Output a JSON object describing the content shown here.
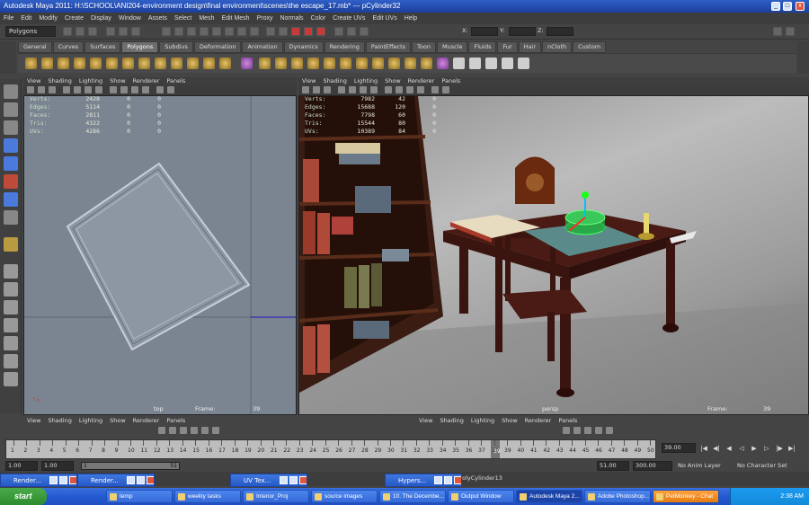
{
  "window": {
    "title": "Autodesk Maya 2011: H:\\SCHOOL\\ANI204-environment design\\final environment\\scenes\\the escape_17.mb*   ---   pCylinder32"
  },
  "menus": [
    "File",
    "Edit",
    "Modify",
    "Create",
    "Display",
    "Window",
    "Assets",
    "Select",
    "Mesh",
    "Edit Mesh",
    "Proxy",
    "Normals",
    "Color",
    "Create UVs",
    "Edit UVs",
    "Help"
  ],
  "status_line": {
    "mode": "Polygons",
    "x_label": "X:",
    "y_label": "Y:",
    "z_label": "Z:"
  },
  "shelf_tabs": [
    "General",
    "Curves",
    "Surfaces",
    "Polygons",
    "Subdivs",
    "Deformation",
    "Animation",
    "Dynamics",
    "Rendering",
    "PaintEffects",
    "Toon",
    "Muscle",
    "Fluids",
    "Fur",
    "Hair",
    "nCloth",
    "Custom"
  ],
  "active_shelf_tab": "Polygons",
  "panel_menu": [
    "View",
    "Shading",
    "Lighting",
    "Show",
    "Renderer",
    "Panels"
  ],
  "left_viewport": {
    "hud_rows": [
      {
        "label": "Verts:",
        "a": "2428",
        "b": "0",
        "c": "0"
      },
      {
        "label": "Edges:",
        "a": "5114",
        "b": "0",
        "c": "0"
      },
      {
        "label": "Faces:",
        "a": "2811",
        "b": "0",
        "c": "0"
      },
      {
        "label": "Tris:",
        "a": "4322",
        "b": "0",
        "c": "0"
      },
      {
        "label": "UVs:",
        "a": "4286",
        "b": "0",
        "c": "0"
      }
    ],
    "camera": "top",
    "frame_label": "Frame:",
    "frame": "39"
  },
  "right_viewport": {
    "hud_rows": [
      {
        "label": "Verts:",
        "a": "7982",
        "b": "42",
        "c": "0"
      },
      {
        "label": "Edges:",
        "a": "15688",
        "b": "120",
        "c": "0"
      },
      {
        "label": "Faces:",
        "a": "7798",
        "b": "60",
        "c": "0"
      },
      {
        "label": "Tris:",
        "a": "15544",
        "b": "80",
        "c": "0"
      },
      {
        "label": "UVs:",
        "a": "10389",
        "b": "84",
        "c": "0"
      }
    ],
    "camera": "persp",
    "frame_label": "Frame:",
    "frame": "39"
  },
  "timeline": {
    "ticks": [
      "1",
      "2",
      "3",
      "4",
      "5",
      "6",
      "7",
      "8",
      "9",
      "10",
      "11",
      "12",
      "13",
      "14",
      "15",
      "16",
      "17",
      "18",
      "19",
      "20",
      "21",
      "22",
      "23",
      "24",
      "25",
      "26",
      "27",
      "28",
      "29",
      "30",
      "31",
      "32",
      "33",
      "34",
      "35",
      "36",
      "37",
      "38",
      "39",
      "40",
      "41",
      "42",
      "43",
      "44",
      "45",
      "46",
      "47",
      "48",
      "49",
      "50"
    ],
    "current_frame": "39.00",
    "current_marker": "39"
  },
  "range": {
    "start": "1.00",
    "playback_start": "1.00",
    "slider_start": "1",
    "slider_end": "51",
    "playback_end": "51.00",
    "end": "300.00",
    "anim_layer": "No Anim Layer",
    "character_set": "No Character Set"
  },
  "command_line": {
    "text": "polyCylinder13"
  },
  "float_windows": [
    {
      "label": "Render..."
    },
    {
      "label": "Render..."
    },
    {
      "label": "UV Tex..."
    },
    {
      "label": "Hypers..."
    }
  ],
  "taskbar": {
    "start_label": "start",
    "items": [
      {
        "label": "temp"
      },
      {
        "label": "weekly tasks"
      },
      {
        "label": "Interior_Proj"
      },
      {
        "label": "source images"
      },
      {
        "label": "10. The Decembe..."
      },
      {
        "label": "Output Window"
      },
      {
        "label": "Autodesk Maya 2..."
      },
      {
        "label": "Adobe Photoshop..."
      },
      {
        "label": "PetMonkey - Chat"
      }
    ],
    "clock": "2:38 AM"
  }
}
